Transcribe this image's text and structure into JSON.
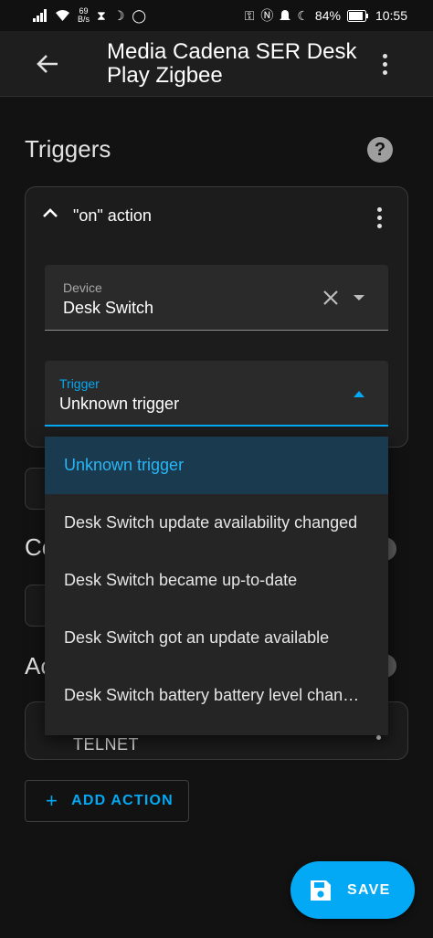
{
  "status_bar": {
    "net_speed_value": "69",
    "net_speed_unit": "B/s",
    "battery": "84%",
    "time": "10:55"
  },
  "app_bar": {
    "title": "Media Cadena SER Desk Play Zigbee"
  },
  "triggers": {
    "section_title": "Triggers",
    "card_label": "\"on\" action",
    "device_field": {
      "label": "Device",
      "value": "Desk Switch"
    },
    "trigger_field": {
      "label": "Trigger",
      "value": "Unknown trigger"
    },
    "menu_options": [
      "Unknown trigger",
      "Desk Switch update availability changed",
      "Desk Switch became up-to-date",
      "Desk Switch got an update available",
      "Desk Switch battery battery level changed"
    ],
    "selected_index": 0
  },
  "conditions": {
    "section_title_partial": "Co"
  },
  "actions": {
    "section_title_partial": "Ac",
    "card_label": "TELNET",
    "add_label": "ADD ACTION"
  },
  "fab": {
    "label": "SAVE"
  },
  "colors": {
    "accent": "#03a9f4",
    "background": "#121212",
    "surface": "#1c1c1c",
    "selected_item_bg": "#1a3a4f"
  }
}
